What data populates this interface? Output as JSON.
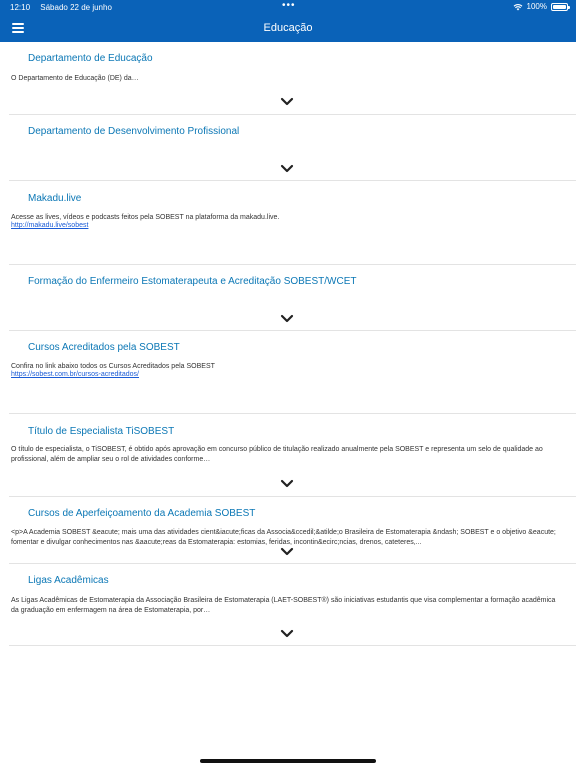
{
  "status_bar": {
    "time": "12:10",
    "date": "Sábado 22 de junho",
    "dots": "•••",
    "battery": "100%",
    "battery_level": 1.0
  },
  "header": {
    "title": "Educação"
  },
  "items": [
    {
      "title": "Departamento de Educação",
      "desc": "O Departamento de Educação (DE) da…",
      "link": ""
    },
    {
      "title": "Departamento de Desenvolvimento Profissional",
      "desc": "",
      "link": ""
    },
    {
      "title": "Makadu.live",
      "desc": "Acesse as lives, vídeos e podcasts feitos pela SOBEST na plataforma da makadu.live.",
      "link": "http://makadu.live/sobest"
    },
    {
      "title": "Formação do Enfermeiro Estomaterapeuta e Acreditação SOBEST/WCET",
      "desc": "",
      "link": ""
    },
    {
      "title": "Cursos Acreditados pela SOBEST",
      "desc": "Confira no link abaixo todos os Cursos Acreditados pela SOBEST",
      "link": "https://sobest.com.br/cursos-acreditados/"
    },
    {
      "title": "Título de Especialista TiSOBEST",
      "desc": "O título de especialista, o TiSOBEST, é obtido após aprovação em concurso público de titulação realizado anualmente pela SOBEST e representa um selo de qualidade ao profissional, além de ampliar seu o rol de atividades conforme…",
      "link": ""
    },
    {
      "title": "Cursos de Aperfeiçoamento da Academia SOBEST",
      "desc": "<p>A Academia SOBEST &eacute; mais uma das atividades cient&iacute;ficas da Associa&ccedil;&atilde;o Brasileira de Estomaterapia &ndash; SOBEST e o objetivo &eacute; fomentar e divulgar conhecimentos nas &aacute;reas da Estomaterapia: estomias, feridas, incontin&ecirc;ncias, drenos, cateteres,...",
      "link": ""
    },
    {
      "title": "Ligas Acadêmicas",
      "desc": "As Ligas Acadêmicas de Estomaterapia da Associação Brasileira de Estomaterapia (LAET-SOBEST®) são iniciativas estudantis que visa complementar a formação acadêmica da graduação em enfermagem na área de Estomaterapia, por…",
      "link": ""
    }
  ]
}
